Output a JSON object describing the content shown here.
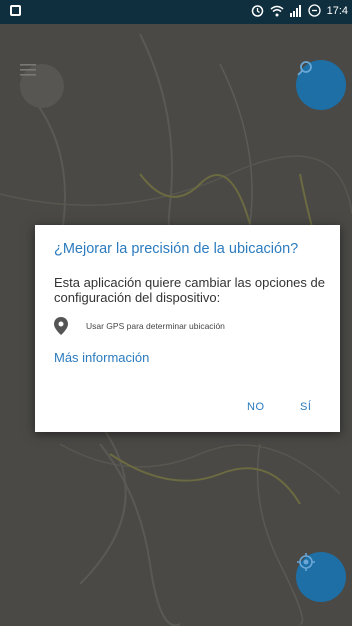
{
  "status_bar": {
    "time": "17:4",
    "icons": [
      "alarm-icon",
      "wifi-icon",
      "signal-icon",
      "battery-icon"
    ]
  },
  "map": {
    "menu_icon": "menu-icon",
    "search_icon": "search-icon",
    "locate_icon": "locate-icon"
  },
  "dialog": {
    "title": "¿Mejorar la precisión de la ubicación?",
    "message": "Esta aplicación quiere cambiar las opciones de configuración del dispositivo:",
    "option": "Usar GPS para determinar ubicación",
    "more_info": "Más información",
    "no_label": "NO",
    "yes_label": "SÍ"
  },
  "colors": {
    "accent": "#2b7bbf",
    "status_bar": "#0f2f3f",
    "fab": "#1d6fa6"
  }
}
